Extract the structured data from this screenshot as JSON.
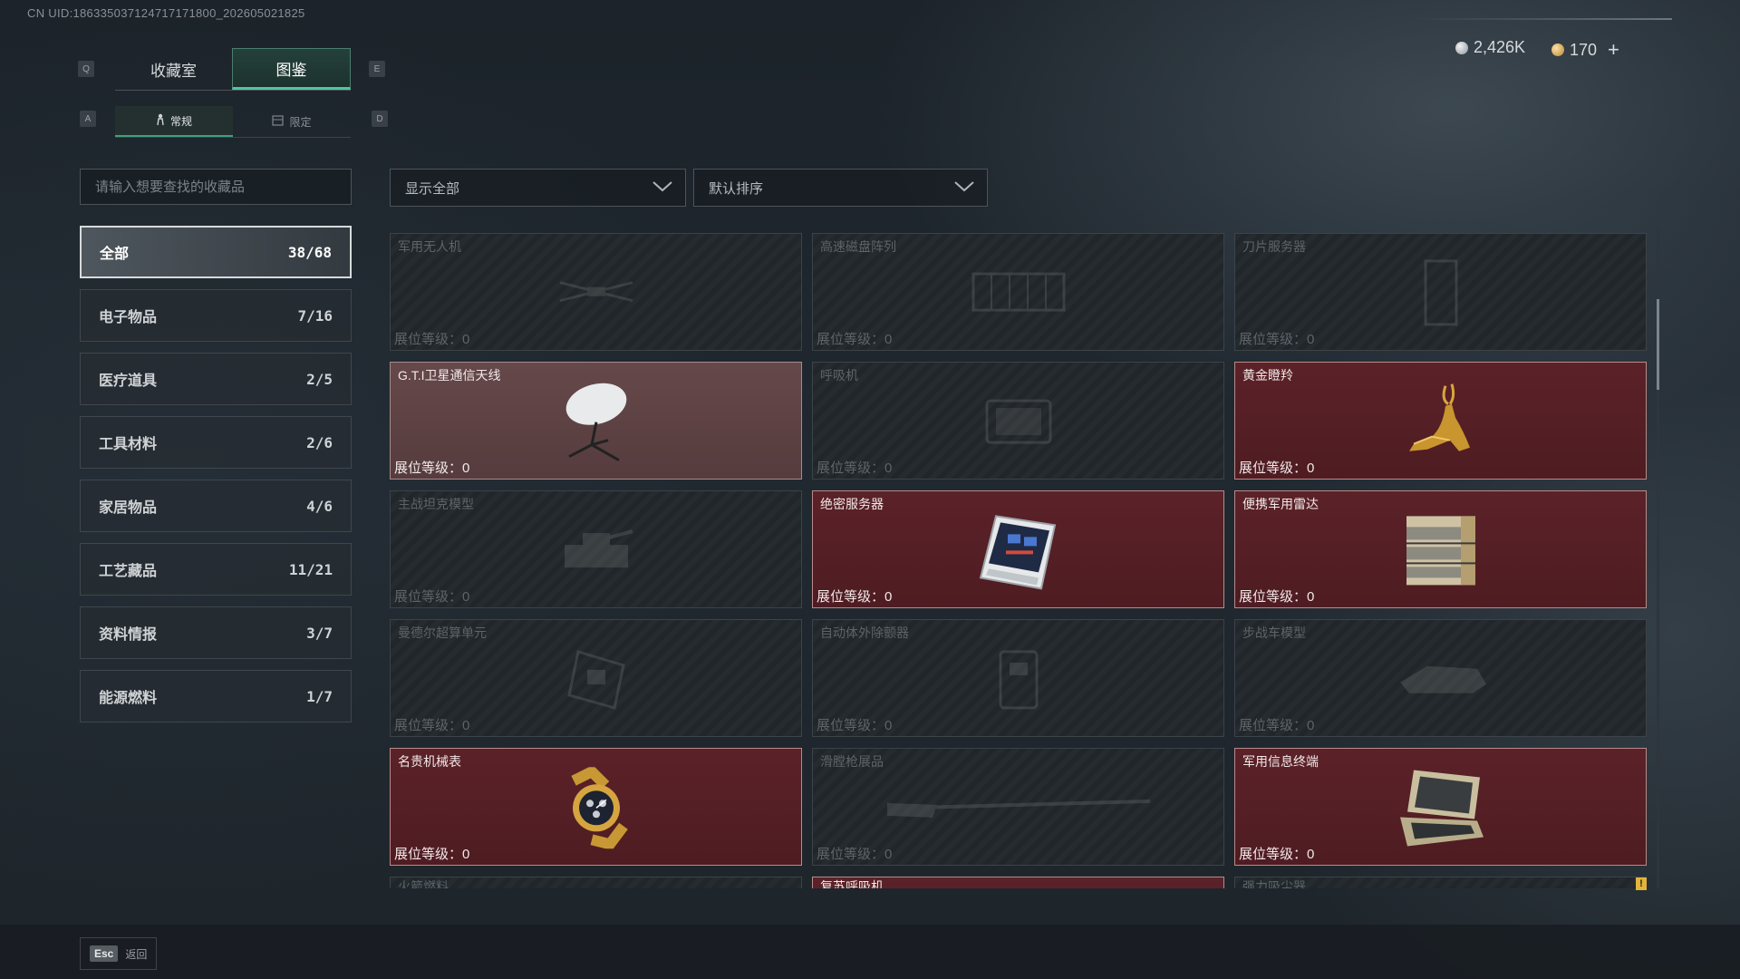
{
  "uid_text": "CN UID:18633503712471717180​0_202605021825",
  "tabs": [
    {
      "label": "收藏室",
      "active": false
    },
    {
      "label": "图鉴",
      "active": true
    }
  ],
  "tab_keys": {
    "left": "Q",
    "right": "E"
  },
  "subtabs": [
    {
      "label": "常规",
      "icon": "person-icon",
      "active": true
    },
    {
      "label": "限定",
      "icon": "box-icon",
      "active": false
    }
  ],
  "subtab_keys": {
    "left": "A",
    "right": "D"
  },
  "currency": {
    "silver": "2,426K",
    "gold": "170",
    "add_label": "+"
  },
  "search": {
    "placeholder": "请输入想要查找的收藏品"
  },
  "filter": {
    "label": "显示全部"
  },
  "sort": {
    "label": "默认排序"
  },
  "categories": [
    {
      "label": "全部",
      "count": "38/68",
      "active": true
    },
    {
      "label": "电子物品",
      "count": "7/16"
    },
    {
      "label": "医疗道具",
      "count": "2/5"
    },
    {
      "label": "工具材料",
      "count": "2/6"
    },
    {
      "label": "家居物品",
      "count": "4/6"
    },
    {
      "label": "工艺藏品",
      "count": "11/21"
    },
    {
      "label": "资料情报",
      "count": "3/7"
    },
    {
      "label": "能源燃料",
      "count": "1/7"
    }
  ],
  "items": [
    {
      "name": "军用无人机",
      "level": "展位等级：0",
      "state": "locked",
      "icon": "drone-icon"
    },
    {
      "name": "高速磁盘阵列",
      "level": "展位等级：0",
      "state": "locked",
      "icon": "disk-array-icon"
    },
    {
      "name": "刀片服务器",
      "level": "展位等级：0",
      "state": "locked",
      "icon": "blade-server-icon"
    },
    {
      "name": "G.T.I卫星通信天线",
      "level": "展位等级：0",
      "state": "special",
      "icon": "satellite-dish-icon"
    },
    {
      "name": "呼吸机",
      "level": "展位等级：0",
      "state": "locked",
      "icon": "ventilator-icon"
    },
    {
      "name": "黄金瞪羚",
      "level": "展位等级：0",
      "state": "owned",
      "icon": "golden-gazelle-icon"
    },
    {
      "name": "主战坦克模型",
      "level": "展位等级：0",
      "state": "locked",
      "icon": "tank-model-icon"
    },
    {
      "name": "绝密服务器",
      "level": "展位等级：0",
      "state": "owned",
      "icon": "secret-server-icon"
    },
    {
      "name": "便携军用雷达",
      "level": "展位等级：0",
      "state": "owned",
      "icon": "radar-icon"
    },
    {
      "name": "曼德尔超算单元",
      "level": "展位等级：0",
      "state": "locked",
      "icon": "compute-unit-icon"
    },
    {
      "name": "自动体外除颤器",
      "level": "展位等级：0",
      "state": "locked",
      "icon": "defibrillator-icon"
    },
    {
      "name": "步战车模型",
      "level": "展位等级：0",
      "state": "locked",
      "icon": "ifv-model-icon"
    },
    {
      "name": "名贵机械表",
      "level": "展位等级：0",
      "state": "owned",
      "icon": "watch-icon"
    },
    {
      "name": "滑膛枪展品",
      "level": "展位等级：0",
      "state": "locked",
      "icon": "musket-icon"
    },
    {
      "name": "军用信息终端",
      "level": "展位等级：0",
      "state": "owned",
      "icon": "terminal-icon"
    },
    {
      "name": "火箭燃料",
      "level": "",
      "state": "locked",
      "icon": "fuel-icon"
    },
    {
      "name": "复苏呼吸机",
      "level": "",
      "state": "owned",
      "icon": "respirator-icon"
    },
    {
      "name": "强力吸尘器",
      "level": "",
      "state": "locked",
      "icon": "vacuum-icon"
    }
  ],
  "warning_badge": "!",
  "footer": {
    "esc_key": "Esc",
    "back_label": "返回"
  },
  "colors": {
    "accent": "#4fc79c",
    "owned_card": "#5b2228",
    "special_card": "#65484a"
  }
}
